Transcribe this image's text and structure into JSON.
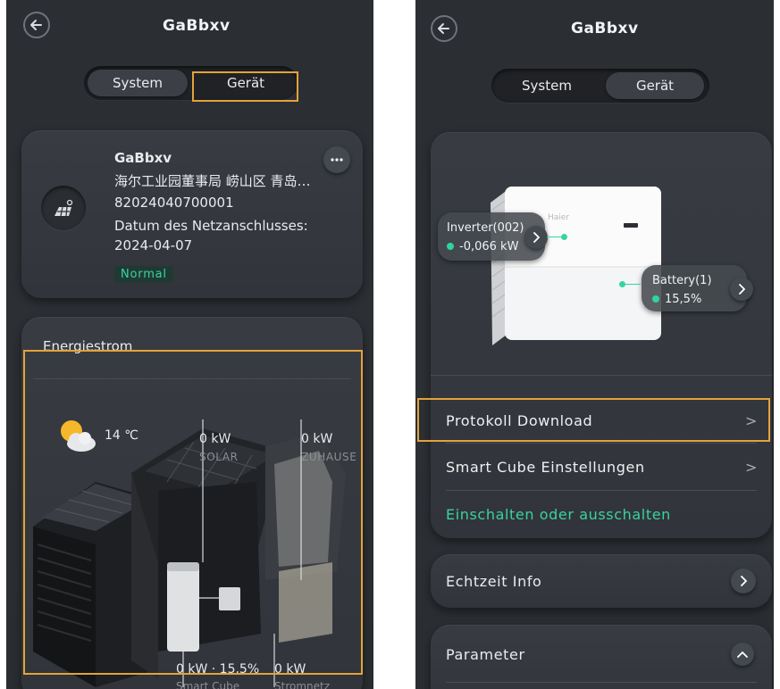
{
  "left": {
    "title": "GaBbxv",
    "tabs": [
      "System",
      "Gerät"
    ],
    "station": {
      "name": "GaBbxv",
      "address": "海尔工业园董事局 崂山区 青岛…",
      "id": "82024040700001",
      "grid_label": "Datum des Netzanschlusses:",
      "grid_date": "2024-04-07",
      "status": "Normal"
    },
    "energy": {
      "title": "Energiestrom",
      "weather_temp": "14 ℃",
      "solar_value": "0 kW",
      "solar_label": "SOLAR",
      "home_value": "0 kW",
      "home_label": "ZUHAUSE",
      "cube_value": "0 kW · 15,5%",
      "cube_label": "Smart Cube",
      "grid_value": "0 kW",
      "grid_label": "Stromnetz"
    }
  },
  "right": {
    "title": "GaBbxv",
    "tabs": [
      "System",
      "Gerät"
    ],
    "device": {
      "brand": "Haier",
      "inverter_label": "Inverter(002)",
      "inverter_value": "-0,066 kW",
      "battery_label": "Battery(1)",
      "battery_value": "15,5%"
    },
    "menu": {
      "protocol": "Protokoll Download",
      "settings": "Smart Cube Einstellungen",
      "power": "Einschalten oder ausschalten",
      "realtime": "Echtzeit Info",
      "params": "Parameter"
    }
  },
  "colors": {
    "highlight": "#e3a33a",
    "accent_green": "#38d3a1",
    "background": "#2b2e33"
  }
}
